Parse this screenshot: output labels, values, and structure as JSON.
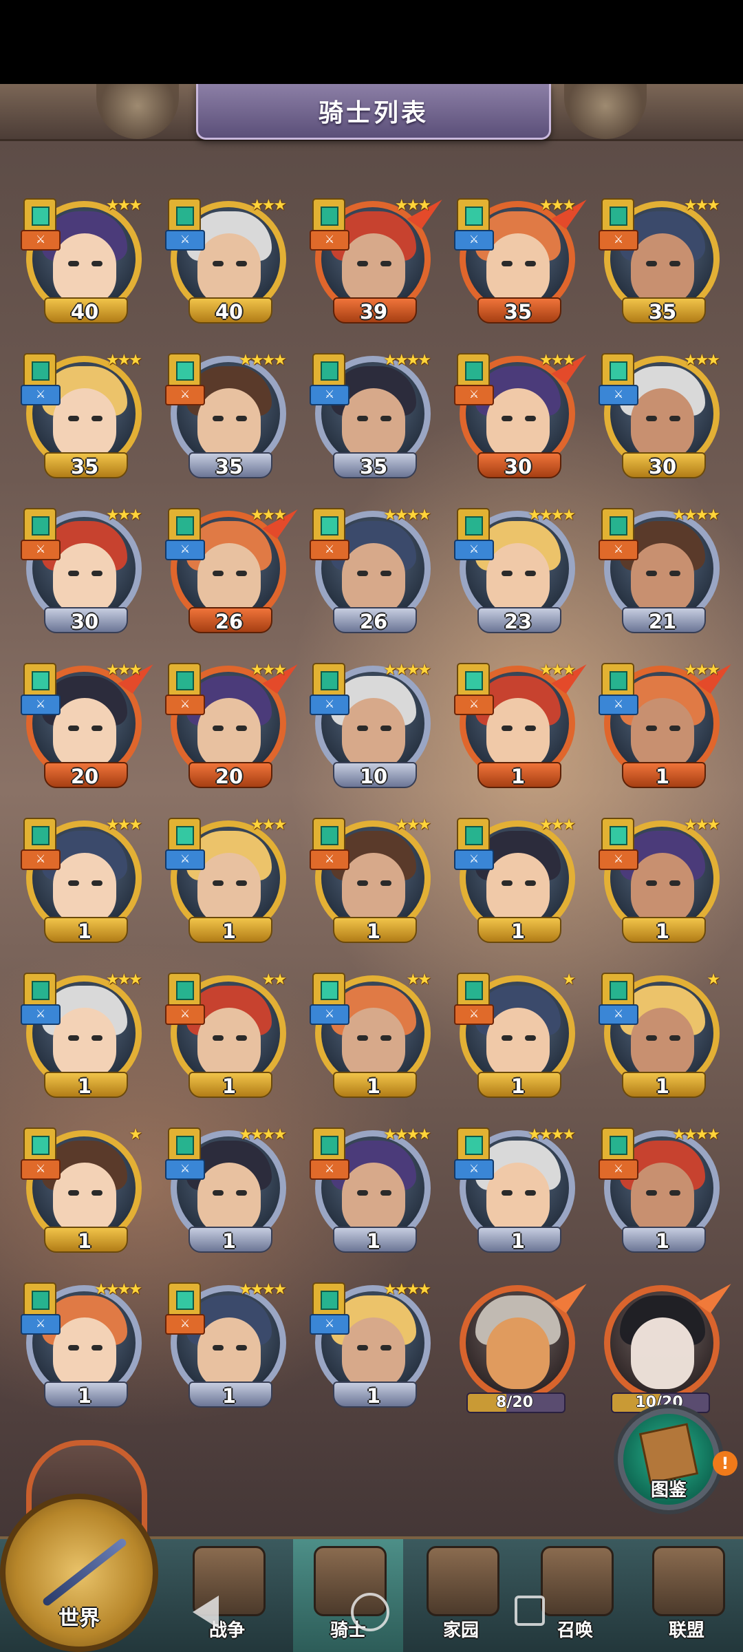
{
  "header": {
    "title": "骑士列表"
  },
  "knights": [
    {
      "level": "40",
      "stars": "★★★",
      "frame": "gold",
      "role": "icon"
    },
    {
      "level": "40",
      "stars": "★★★",
      "frame": "gold",
      "role": "icon"
    },
    {
      "level": "39",
      "stars": "★★★",
      "frame": "orange",
      "role": "icon"
    },
    {
      "level": "35",
      "stars": "★★★",
      "frame": "orange",
      "role": "icon"
    },
    {
      "level": "35",
      "stars": "★★★",
      "frame": "gold",
      "role": "icon"
    },
    {
      "level": "35",
      "stars": "★★★",
      "frame": "gold",
      "role": "icon"
    },
    {
      "level": "35",
      "stars": "★★★★",
      "frame": "blue",
      "role": "icon"
    },
    {
      "level": "35",
      "stars": "★★★★",
      "frame": "blue",
      "role": "icon"
    },
    {
      "level": "30",
      "stars": "★★★",
      "frame": "orange",
      "role": "icon"
    },
    {
      "level": "30",
      "stars": "★★★",
      "frame": "gold",
      "role": "icon"
    },
    {
      "level": "30",
      "stars": "★★★",
      "frame": "blue",
      "role": "icon"
    },
    {
      "level": "26",
      "stars": "★★★",
      "frame": "orange",
      "role": "icon"
    },
    {
      "level": "26",
      "stars": "★★★★",
      "frame": "blue",
      "role": "icon"
    },
    {
      "level": "23",
      "stars": "★★★★",
      "frame": "blue",
      "role": "icon"
    },
    {
      "level": "21",
      "stars": "★★★★",
      "frame": "blue",
      "role": "icon"
    },
    {
      "level": "20",
      "stars": "★★★",
      "frame": "orange",
      "role": "icon"
    },
    {
      "level": "20",
      "stars": "★★★",
      "frame": "orange",
      "role": "icon"
    },
    {
      "level": "10",
      "stars": "★★★★",
      "frame": "blue",
      "role": "icon"
    },
    {
      "level": "1",
      "stars": "★★★",
      "frame": "orange",
      "role": "icon"
    },
    {
      "level": "1",
      "stars": "★★★",
      "frame": "orange",
      "role": "icon"
    },
    {
      "level": "1",
      "stars": "★★★",
      "frame": "gold",
      "role": "icon"
    },
    {
      "level": "1",
      "stars": "★★★",
      "frame": "gold",
      "role": "icon"
    },
    {
      "level": "1",
      "stars": "★★★",
      "frame": "gold",
      "role": "icon"
    },
    {
      "level": "1",
      "stars": "★★★",
      "frame": "gold",
      "role": "icon"
    },
    {
      "level": "1",
      "stars": "★★★",
      "frame": "gold",
      "role": "icon"
    },
    {
      "level": "1",
      "stars": "★★★",
      "frame": "gold",
      "role": "icon"
    },
    {
      "level": "1",
      "stars": "★★",
      "frame": "gold",
      "role": "icon"
    },
    {
      "level": "1",
      "stars": "★★",
      "frame": "gold",
      "role": "icon"
    },
    {
      "level": "1",
      "stars": "★",
      "frame": "gold",
      "role": "icon"
    },
    {
      "level": "1",
      "stars": "★",
      "frame": "gold",
      "role": "icon"
    },
    {
      "level": "1",
      "stars": "★",
      "frame": "gold",
      "role": "icon"
    },
    {
      "level": "1",
      "stars": "★★★★",
      "frame": "blue",
      "role": "icon"
    },
    {
      "level": "1",
      "stars": "★★★★",
      "frame": "blue",
      "role": "icon"
    },
    {
      "level": "1",
      "stars": "★★★★",
      "frame": "blue",
      "role": "icon"
    },
    {
      "level": "1",
      "stars": "★★★★",
      "frame": "blue",
      "role": "icon"
    },
    {
      "level": "1",
      "stars": "★★★★",
      "frame": "blue",
      "role": "icon"
    },
    {
      "level": "1",
      "stars": "★★★★",
      "frame": "blue",
      "role": "icon"
    },
    {
      "level": "1",
      "stars": "★★★★",
      "frame": "blue",
      "role": "icon"
    }
  ],
  "locked_knights": [
    {
      "progress": "8/20",
      "fraction": 0.4
    },
    {
      "progress": "10/20",
      "fraction": 0.5
    }
  ],
  "handbook": {
    "label": "图鉴"
  },
  "nav": {
    "world": "世界",
    "items": [
      "战争",
      "骑士",
      "家园",
      "召唤",
      "联盟"
    ],
    "active": "骑士"
  },
  "notification": "!",
  "colors": {
    "gold": "#d9a52a",
    "orange": "#e0662c",
    "blue": "#9aa6c4",
    "accent": "#5b4f79"
  }
}
